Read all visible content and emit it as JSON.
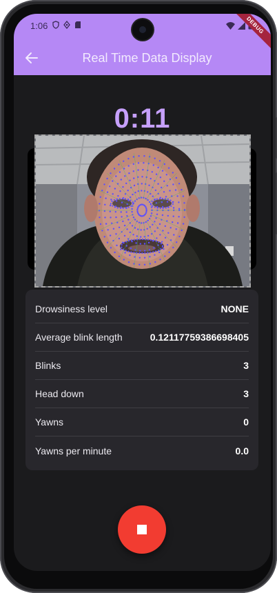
{
  "status_bar": {
    "time": "1:06",
    "debug_label": "DEBUG"
  },
  "appbar": {
    "title": "Real Time Data Display",
    "back_icon": "arrow-left-icon"
  },
  "timer": "0:11",
  "metrics": [
    {
      "label": "Drowsiness level",
      "value": "NONE"
    },
    {
      "label": "Average blink length",
      "value": "0.12117759386698405"
    },
    {
      "label": "Blinks",
      "value": "3"
    },
    {
      "label": "Head down",
      "value": "3"
    },
    {
      "label": "Yawns",
      "value": "0"
    },
    {
      "label": "Yawns per minute",
      "value": "0.0"
    }
  ],
  "stop_button": {
    "icon": "stop-icon"
  },
  "colors": {
    "appbar": "#b588f5",
    "timer": "#c6a0fb",
    "background": "#1b1b1d",
    "card": "#28272c",
    "stop_button": "#f23c31",
    "landmark_dots": "#5b4fff",
    "landmark_lines": "#3cc35a"
  }
}
